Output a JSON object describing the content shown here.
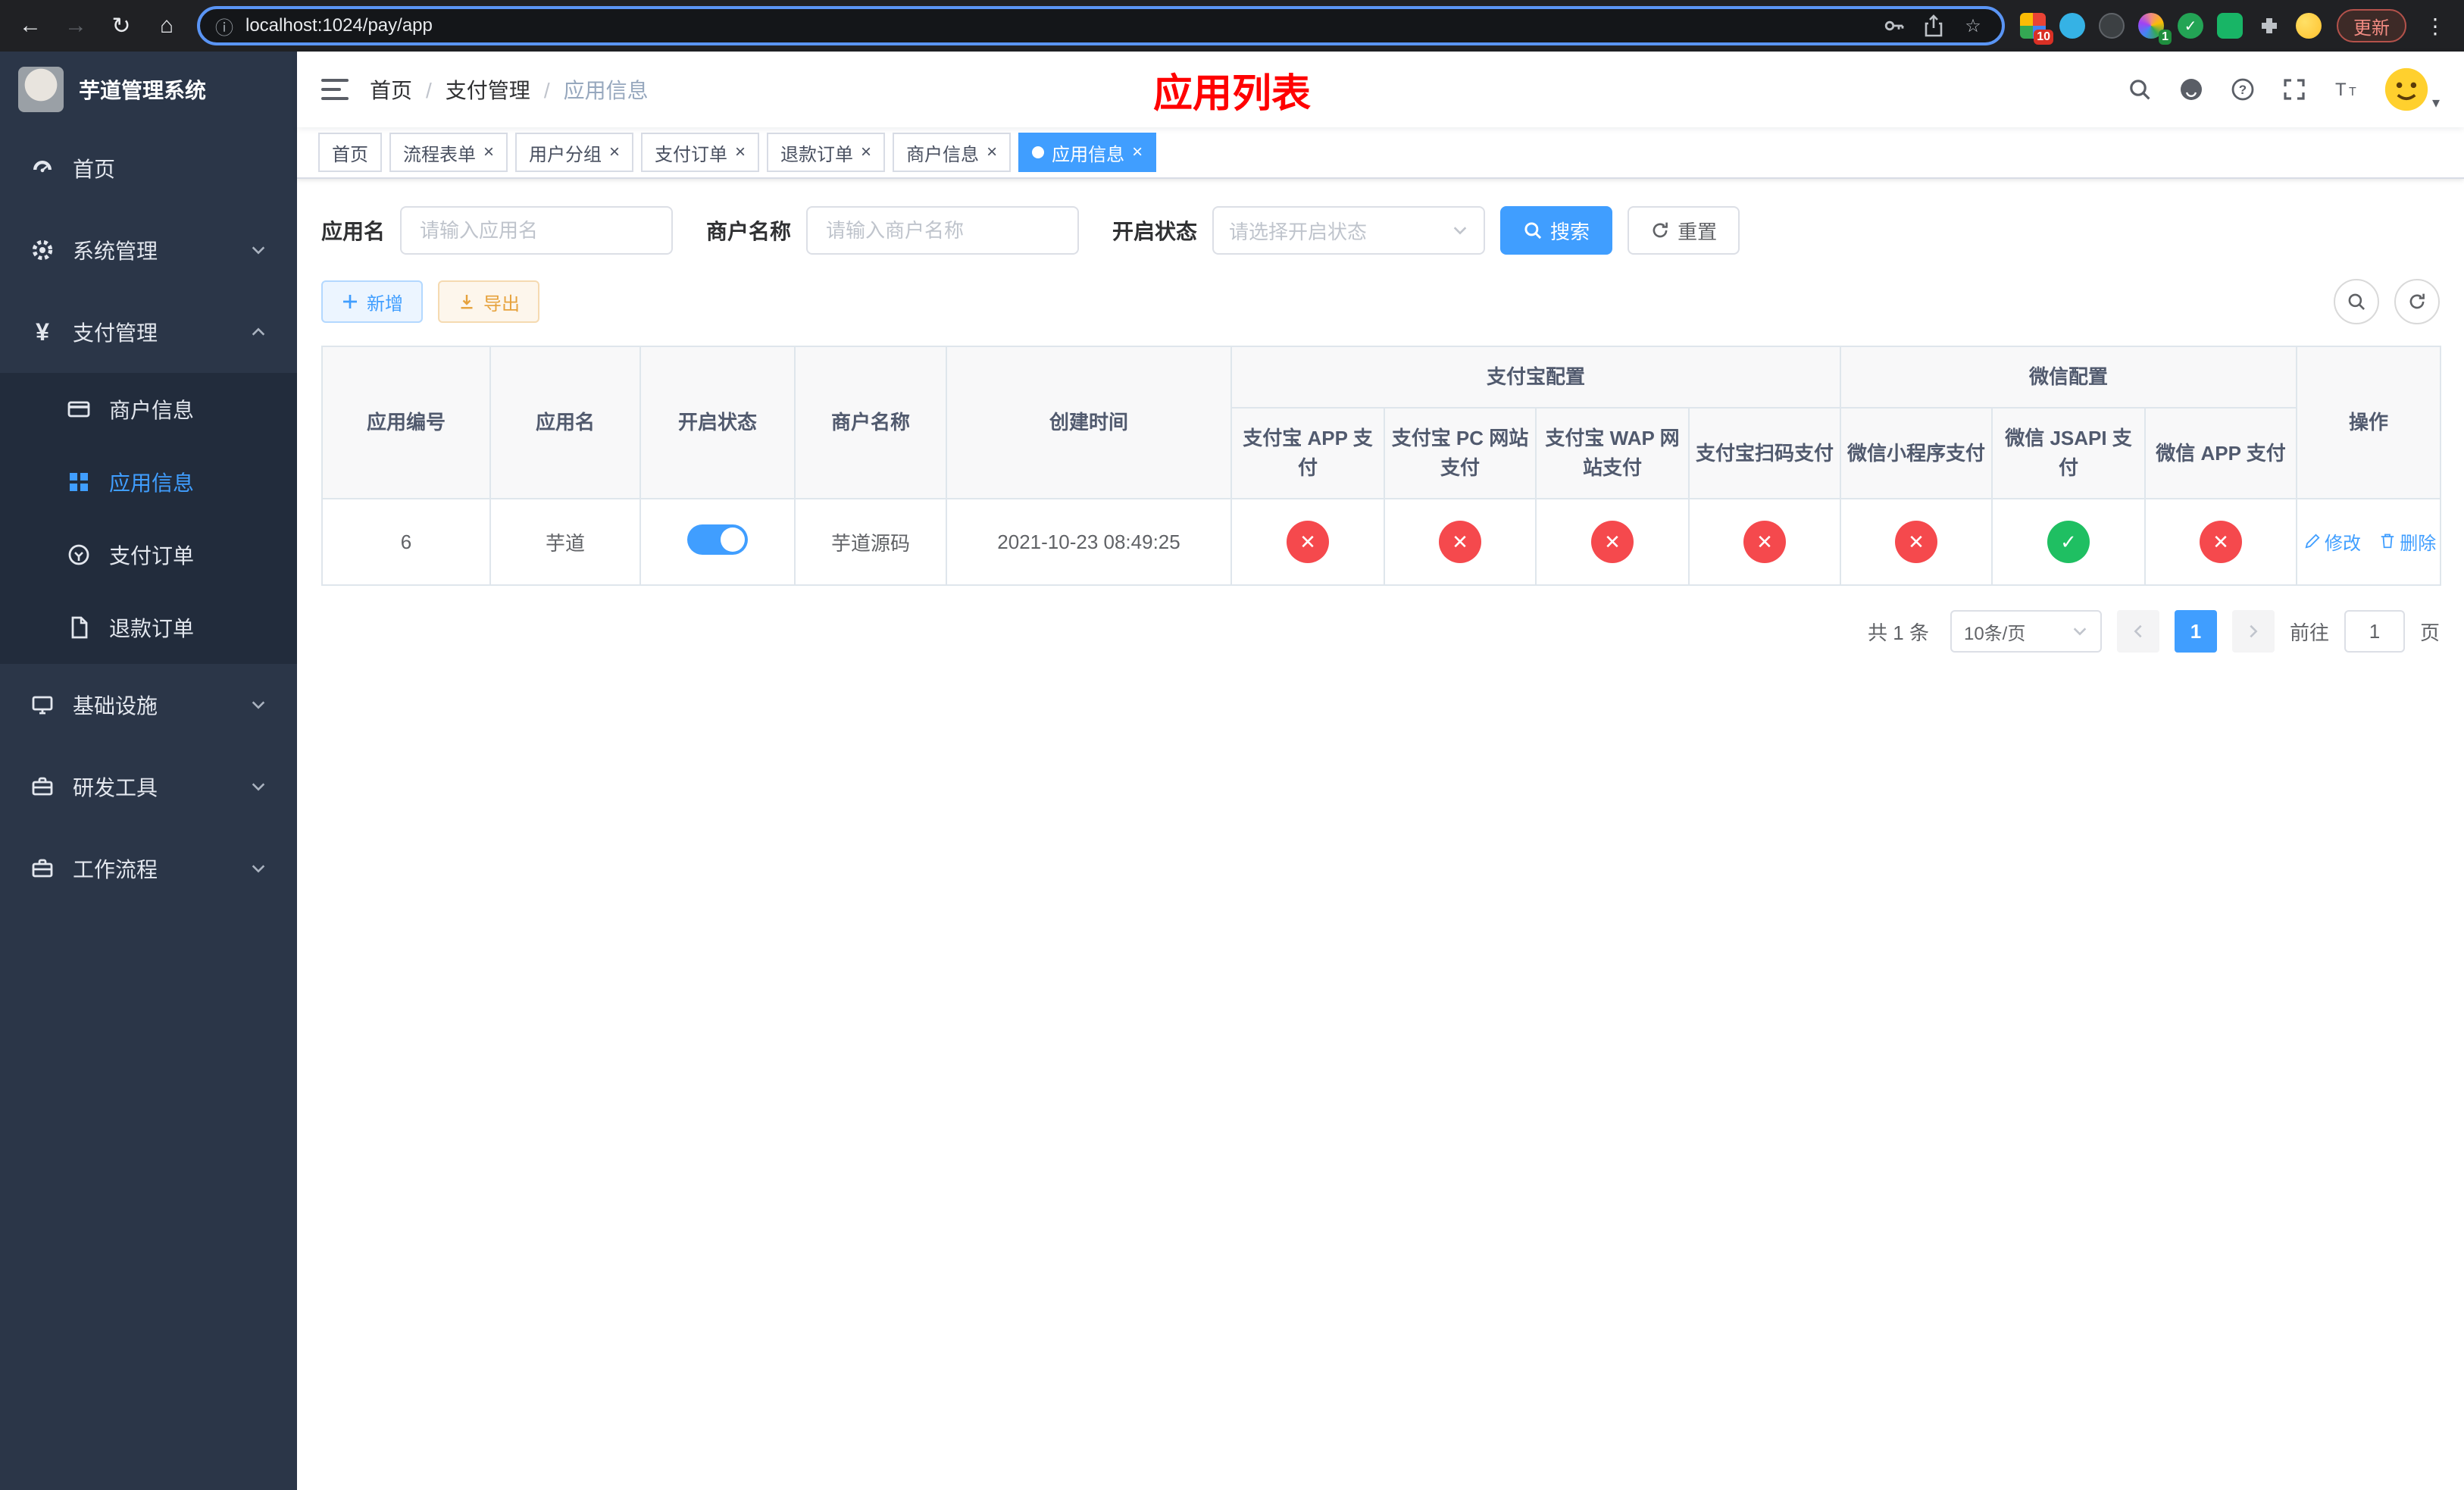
{
  "browser": {
    "url": "localhost:1024/pay/app",
    "update_label": "更新",
    "ext_badge_grid": "10",
    "ext_badge_color": "1"
  },
  "icons": {
    "back": "←",
    "forward": "→",
    "reload": "↻",
    "home": "⌂",
    "info": "ⓘ",
    "star": "☆",
    "overflow": "⋮",
    "close": "×",
    "yen": "¥",
    "caret_down": "▾"
  },
  "colors": {
    "accent": "#409eff",
    "danger": "#f5494d",
    "success": "#1fbf62",
    "warning": "#e6a23c",
    "page_title_red": "#ff0000",
    "sidebar_bg": "#2b3648"
  },
  "sidebar": {
    "logo_title": "芋道管理系统",
    "home": "首页",
    "system": "系统管理",
    "payment": "支付管理",
    "payment_children": [
      "商户信息",
      "应用信息",
      "支付订单",
      "退款订单"
    ],
    "infra": "基础设施",
    "devtools": "研发工具",
    "workflow": "工作流程"
  },
  "header": {
    "breadcrumb": [
      "首页",
      "支付管理",
      "应用信息"
    ],
    "page_title": "应用列表"
  },
  "tabs": [
    {
      "label": "首页"
    },
    {
      "label": "流程表单"
    },
    {
      "label": "用户分组"
    },
    {
      "label": "支付订单"
    },
    {
      "label": "退款订单"
    },
    {
      "label": "商户信息"
    },
    {
      "label": "应用信息"
    }
  ],
  "filters": {
    "app_name_label": "应用名",
    "app_name_placeholder": "请输入应用名",
    "merchant_label": "商户名称",
    "merchant_placeholder": "请输入商户名称",
    "status_label": "开启状态",
    "status_placeholder": "请选择开启状态",
    "search_button": "搜索",
    "reset_button": "重置"
  },
  "toolbar": {
    "add_button": "新增",
    "export_button": "导出"
  },
  "table": {
    "group_alipay": "支付宝配置",
    "group_wechat": "微信配置",
    "col_id": "应用编号",
    "col_name": "应用名",
    "col_status": "开启状态",
    "col_merchant": "商户名称",
    "col_created": "创建时间",
    "col_actions": "操作",
    "alipay_cols": [
      "支付宝 APP 支付",
      "支付宝 PC 网站支付",
      "支付宝 WAP 网站支付",
      "支付宝扫码支付"
    ],
    "wechat_cols": [
      "微信小程序支付",
      "微信 JSAPI 支付",
      "微信 APP 支付"
    ],
    "row": {
      "id": "6",
      "name": "芋道",
      "status": "on",
      "merchant": "芋道源码",
      "created": "2021-10-23 08:49:25",
      "alipay_app": "no",
      "alipay_pc": "no",
      "alipay_wap": "no",
      "alipay_qr": "no",
      "wechat_mini": "no",
      "wechat_jsapi": "yes",
      "wechat_app": "no",
      "edit_label": "修改",
      "delete_label": "删除"
    }
  },
  "pagination": {
    "total": "共 1 条",
    "page_size": "10条/页",
    "page": "1",
    "goto_label": "前往",
    "goto_value": "1",
    "unit_label": "页"
  }
}
